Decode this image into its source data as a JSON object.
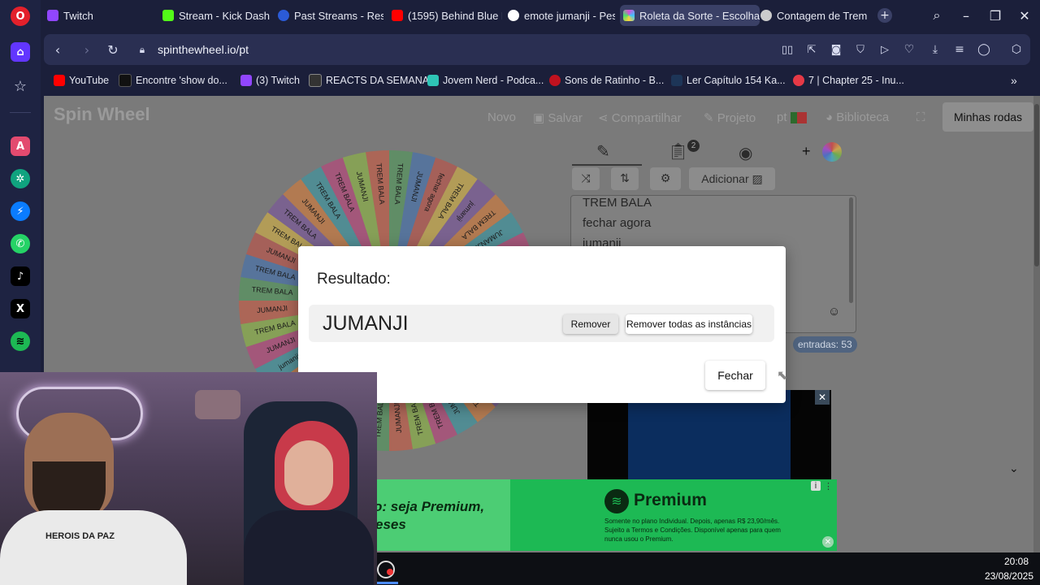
{
  "browser": {
    "tabs": [
      {
        "label": "Twitch",
        "favicon_color": "#9146ff"
      },
      {
        "label": "Stream - Kick Dashbo",
        "favicon_color": "#53fc18"
      },
      {
        "label": "Past Streams - Restre",
        "favicon_color": "#2b5bd7"
      },
      {
        "label": "(1595) Behind Blue E",
        "favicon_color": "#ff0000"
      },
      {
        "label": "emote jumanji - Pesq",
        "favicon_color": "#ffffff"
      },
      {
        "label": "Roleta da Sorte - Escolha",
        "favicon_color": "#e04ad8"
      },
      {
        "label": "Contagem de Trem B",
        "favicon_color": "#cccccc"
      }
    ],
    "active_tab": 5,
    "new_tab_icon": "plus-icon",
    "url": "spinthewheel.io/pt",
    "bookmarks": [
      {
        "label": "YouTube",
        "color": "#ff0000"
      },
      {
        "label": "Encontre 'show do...",
        "color": "#111111"
      },
      {
        "label": "(3) Twitch",
        "color": "#9146ff"
      },
      {
        "label": "REACTS DA SEMANA",
        "color": "#333333"
      },
      {
        "label": "Jovem Nerd - Podca...",
        "color": "#2ec4b6"
      },
      {
        "label": "Sons de Ratinho - B...",
        "color": "#c1121f"
      },
      {
        "label": "Ler Capítulo 154 Ka...",
        "color": "#1d3557"
      },
      {
        "label": "7 | Chapter 25 - Inu...",
        "color": "#e63946"
      }
    ]
  },
  "site": {
    "logo": "Spin Wheel",
    "nav": {
      "novo": "Novo",
      "salvar": "Salvar",
      "compartilhar": "Compartilhar",
      "projeto": "Projeto",
      "lang": "pt",
      "biblioteca": "Biblioteca",
      "minhas_rodas": "Minhas rodas"
    },
    "editor": {
      "results_badge": "2",
      "adicionar": "Adicionar",
      "entries_visible": [
        "TREM BALA",
        "fechar agora",
        "jumanji"
      ],
      "entries_count": "entradas: 53"
    },
    "wheel_labels": [
      "TREM BALA",
      "JUMANJI",
      "fechar agora",
      "TREM BALA",
      "jumanji",
      "TREM BALA",
      "JUMANJI",
      "TREM BALA",
      "BUMBLEBEE",
      "JUMANJI",
      "trem bala",
      "JUMANJI",
      "JUMANJI",
      "OS ANEIS",
      "JUMANJI",
      "TREM BALA",
      "JUMANJI",
      "TREM BALA",
      "TREM BALA",
      "JUMANJI",
      "TREM BALA",
      "JUMANJI",
      "TREM BALA",
      "TREM BALA",
      "JUMANJI",
      "TREM BALA",
      "jumanji",
      "JUMANJI",
      "TREM BALA",
      "JUMANJI",
      "TREM BALA",
      "TREM BALA",
      "JUMANJI",
      "TREM BALA",
      "TREM BALA",
      "JUMANJI",
      "TREM BALA",
      "TREM BALA",
      "JUMANJI",
      "TREM BALA"
    ],
    "wheel_colors": [
      "#4a9c55",
      "#3b6fb7",
      "#c94a3e",
      "#e0b83a",
      "#7a4ea0",
      "#e07a2f",
      "#2f9aa8",
      "#c43a7a",
      "#8fbf3a",
      "#d6553a"
    ]
  },
  "modal": {
    "title": "Resultado:",
    "result": "JUMANJI",
    "remove": "Remover",
    "remove_all": "Remover todas as instâncias",
    "close": "Fechar"
  },
  "ads": {
    "premium_title": "Premium",
    "premium_text": "Somente no plano Individual. Depois, apenas R$ 23,90/mês. Sujeito a Termos e Condições. Disponível apenas para quem nunca usou o Premium.",
    "left_text_1": "o: seja Premium,",
    "left_text_2": "eses"
  },
  "webcam": {
    "shirt_text": "HEROIS DA PAZ"
  },
  "taskbar": {
    "time": "20:08",
    "date": "23/08/2025"
  }
}
